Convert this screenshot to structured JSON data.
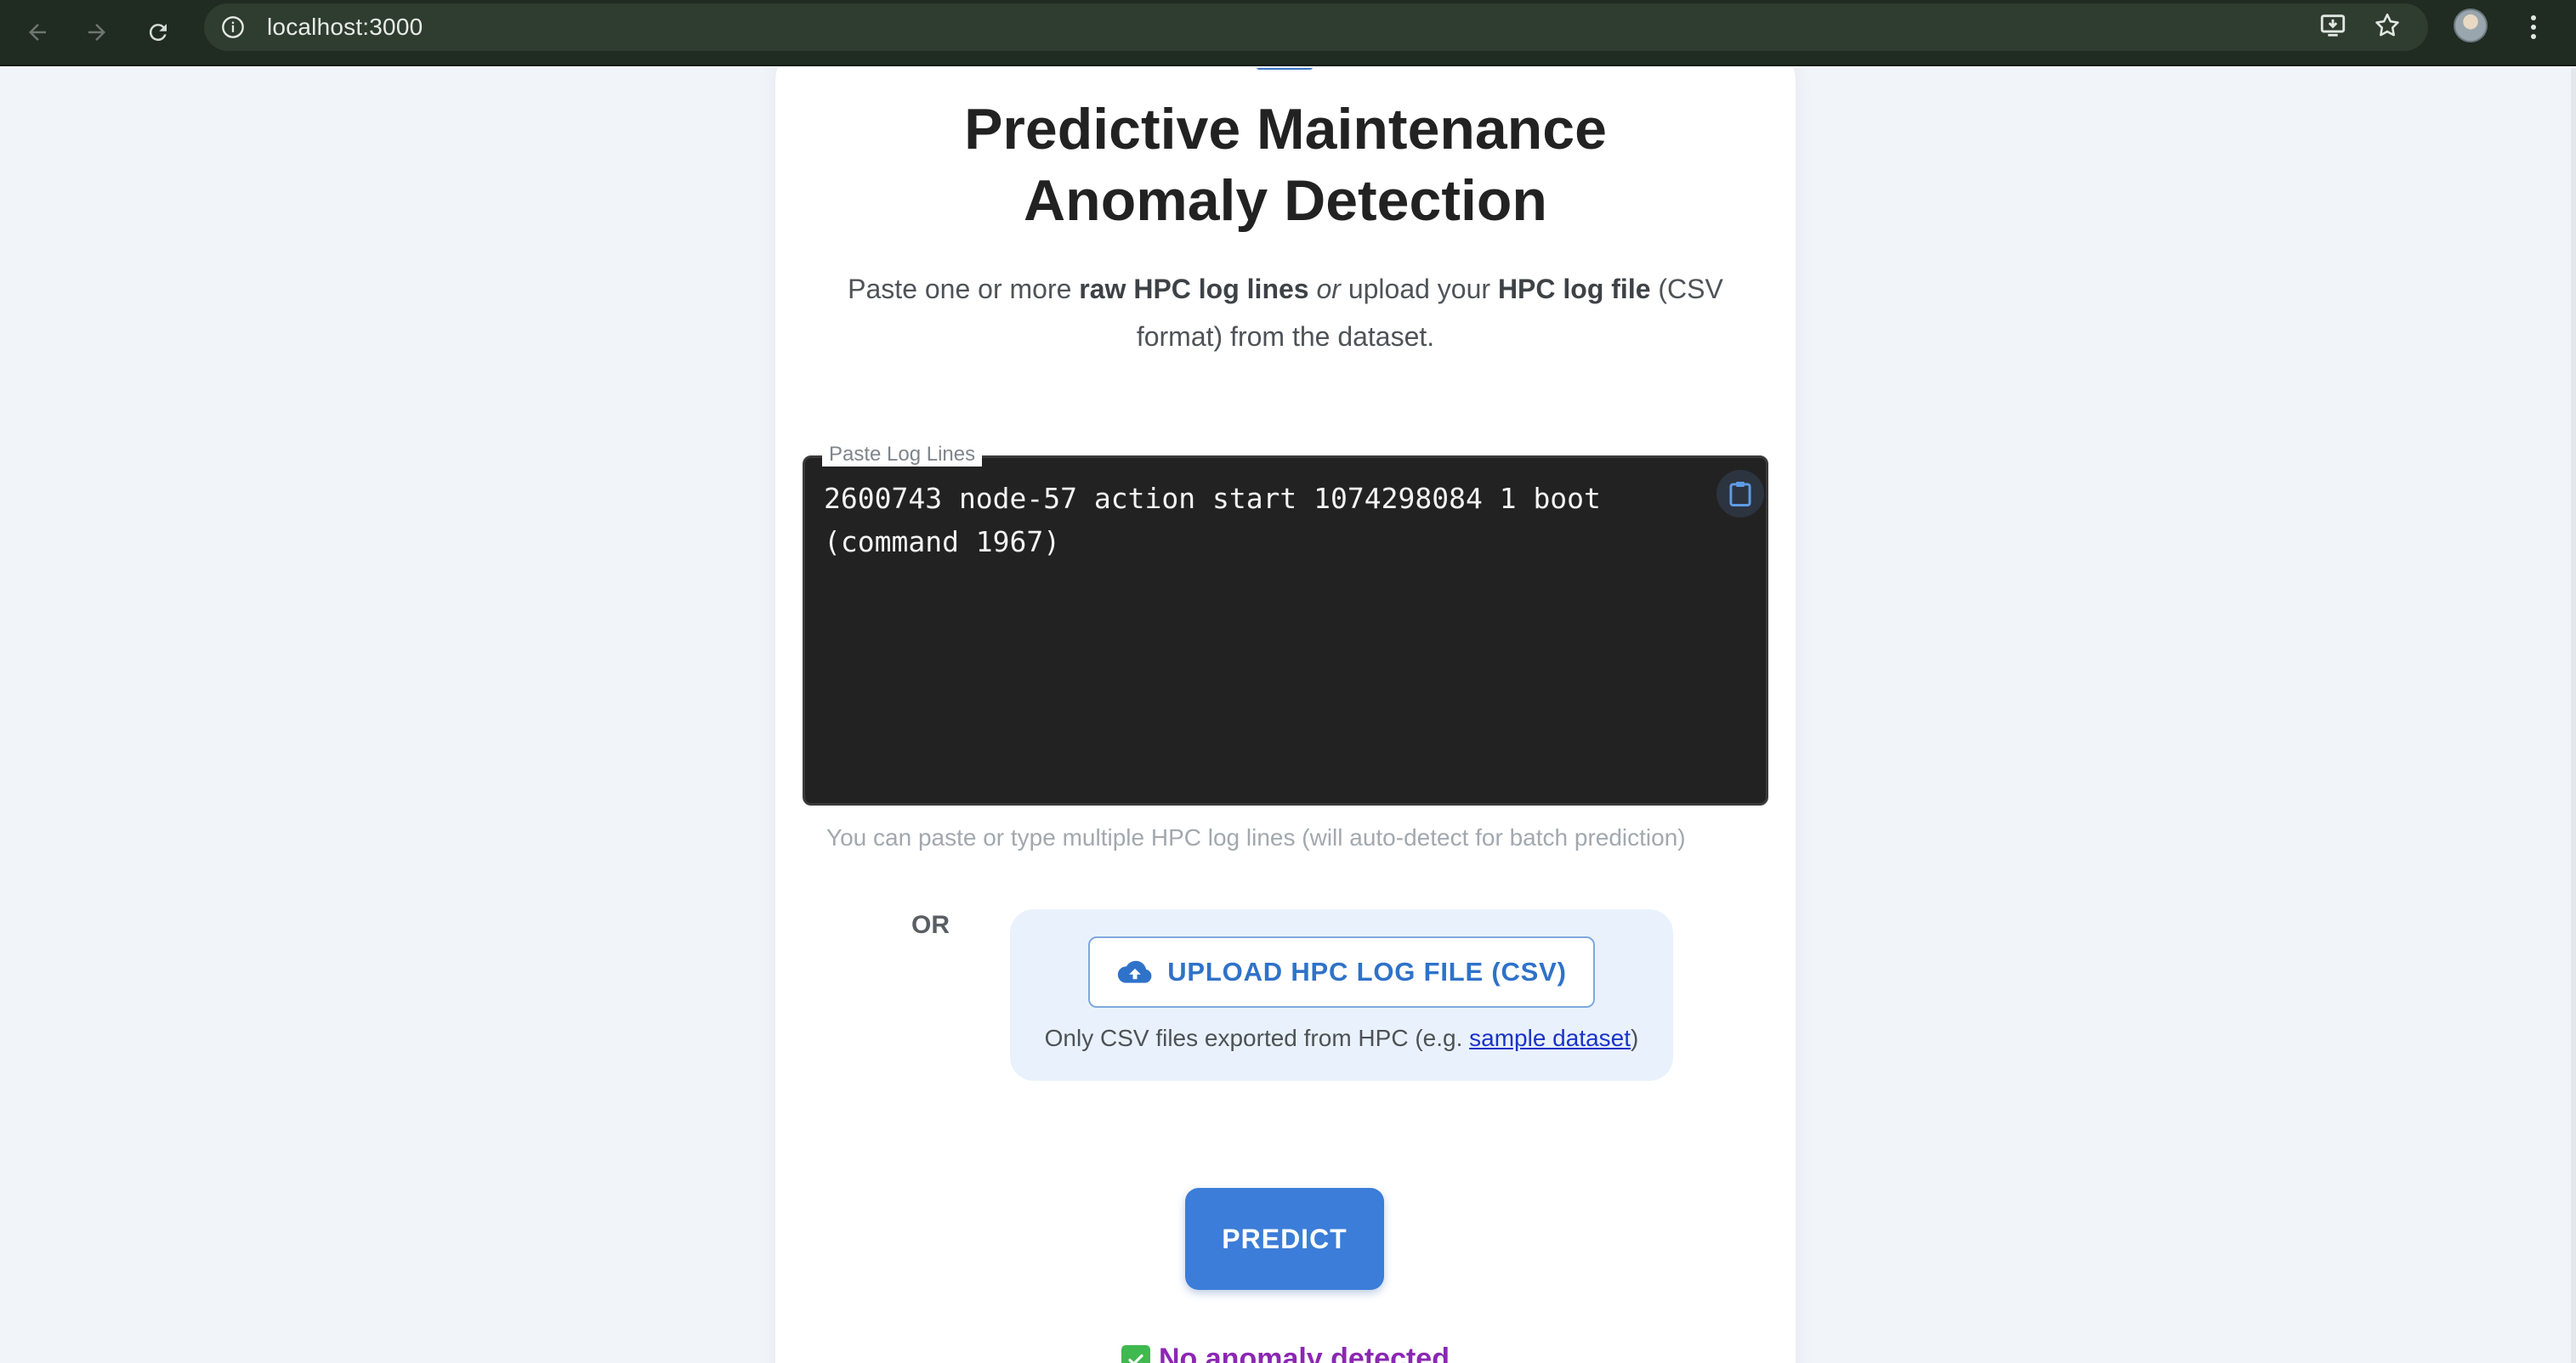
{
  "browser": {
    "url": "localhost:3000"
  },
  "page": {
    "title_line1": "Predictive Maintenance",
    "title_line2": "Anomaly Detection",
    "subtitle": {
      "prefix": "Paste one or more ",
      "bold1": "raw HPC log lines",
      "or_word": "or",
      "middle": " upload your ",
      "bold2": "HPC log file",
      "suffix": " (CSV format) from the dataset."
    },
    "log_field": {
      "label": "Paste Log Lines",
      "value": "2600743 node-57 action start 1074298084 1 boot\n(command 1967)"
    },
    "helper_text": "You can paste or type multiple HPC log lines (will auto-detect for batch prediction)",
    "or_label": "OR",
    "upload": {
      "button_label": "UPLOAD HPC LOG FILE (CSV)",
      "note_prefix": "Only CSV files exported from HPC (e.g. ",
      "note_link": "sample dataset",
      "note_suffix": ")"
    },
    "predict_label": "PREDICT",
    "result": {
      "text": "No anomaly detected",
      "color": "#8b27b3"
    },
    "colors": {
      "accent": "#3b7dd8",
      "editor_bg": "#222222"
    }
  }
}
